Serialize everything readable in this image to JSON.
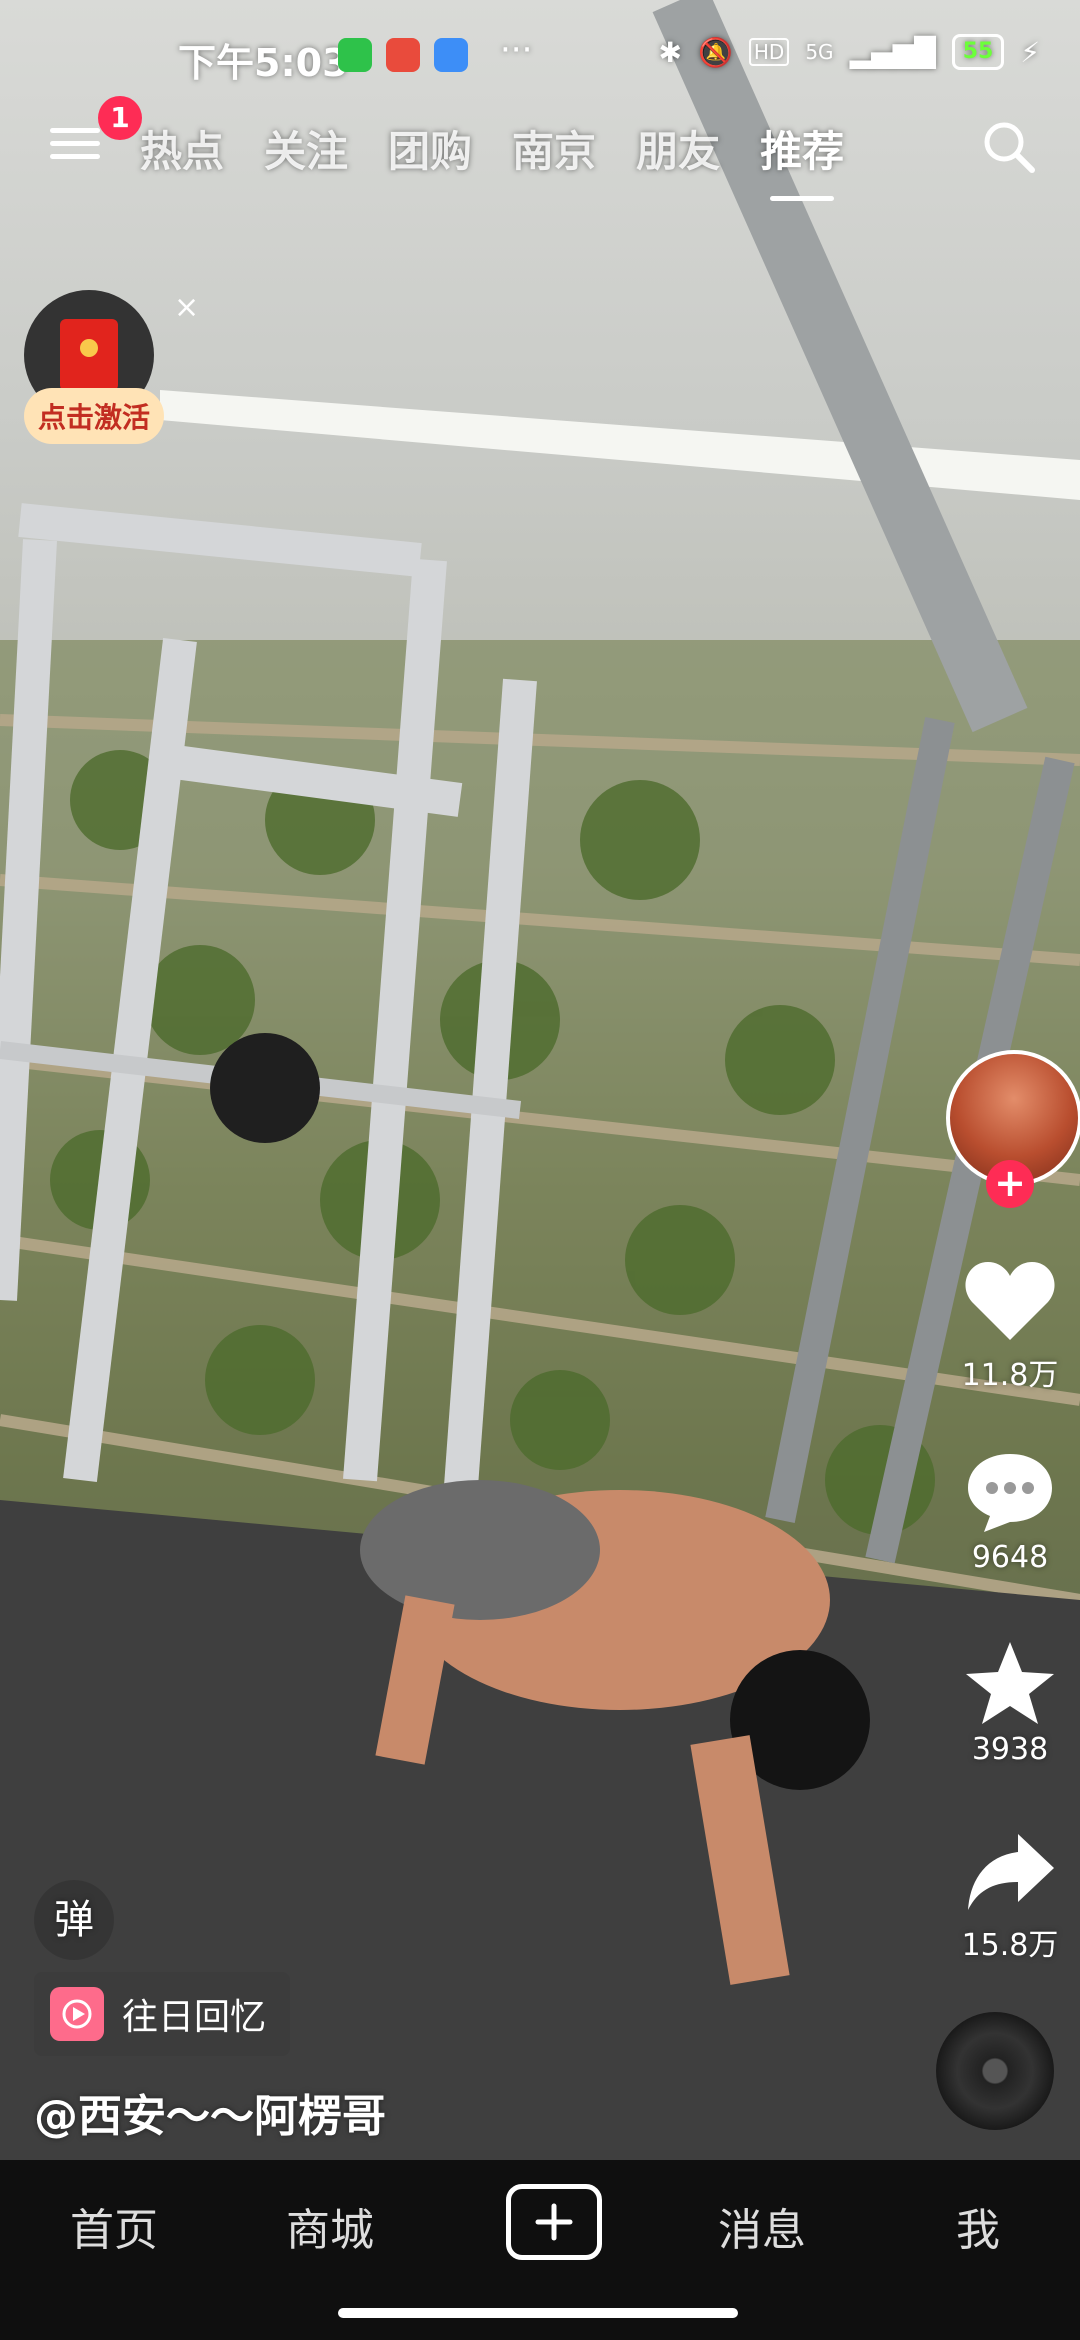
{
  "status_bar": {
    "time": "下午5:03",
    "apps": [
      {
        "icon": "wechat-mini-app-icon",
        "color": "#2ec24a"
      },
      {
        "icon": "58-app-icon",
        "color": "#e94b3c"
      },
      {
        "icon": "baidu-netdisk-icon",
        "color": "#3d8ef7"
      }
    ],
    "more": "···",
    "network": "5G",
    "hd": "HD",
    "battery": "55"
  },
  "top_nav": {
    "notification_count": "1",
    "tabs": [
      {
        "label": "热点",
        "active": false
      },
      {
        "label": "关注",
        "active": false
      },
      {
        "label": "团购",
        "active": false
      },
      {
        "label": "南京",
        "active": false
      },
      {
        "label": "朋友",
        "active": false
      },
      {
        "label": "推荐",
        "active": true
      }
    ]
  },
  "red_packet": {
    "close": "×",
    "label": "点击激活"
  },
  "actions": {
    "like_count": "11.8万",
    "comment_count": "9648",
    "favorite_count": "3938",
    "share_count": "15.8万",
    "follow_plus": "+"
  },
  "danmu_label": "弹",
  "memory_label": "往日回忆",
  "author": "@西安～～阿楞哥",
  "bottom_nav": {
    "home": "首页",
    "mall": "商城",
    "messages": "消息",
    "me": "我"
  },
  "colors": {
    "accent": "#fe2c55",
    "nav_bg": "#0f0f0f"
  }
}
